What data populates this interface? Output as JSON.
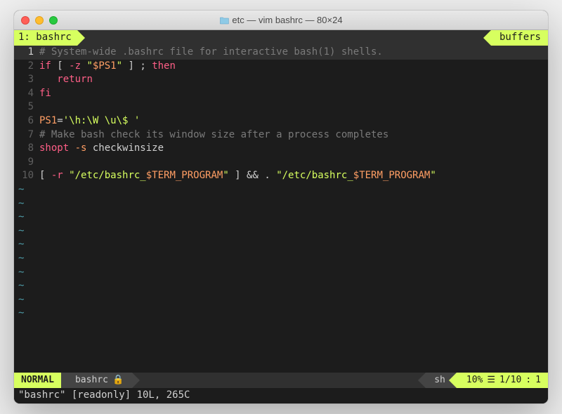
{
  "window": {
    "title": "etc — vim bashrc — 80×24"
  },
  "tabline": {
    "left": "1: bashrc",
    "right": "buffers"
  },
  "code": {
    "lines": [
      {
        "num": "1",
        "current": true,
        "segments": [
          {
            "cls": "c-comment",
            "t": "# System-wide .bashrc file for interactive bash(1) shells."
          }
        ]
      },
      {
        "num": "2",
        "segments": [
          {
            "cls": "c-keyword",
            "t": "if"
          },
          {
            "cls": "c-op",
            "t": " [ "
          },
          {
            "cls": "c-keyword",
            "t": "-z"
          },
          {
            "cls": "c-op",
            "t": " "
          },
          {
            "cls": "c-string",
            "t": "\""
          },
          {
            "cls": "c-var",
            "t": "$PS1"
          },
          {
            "cls": "c-string",
            "t": "\""
          },
          {
            "cls": "c-op",
            "t": " ] ; "
          },
          {
            "cls": "c-keyword",
            "t": "then"
          }
        ]
      },
      {
        "num": "3",
        "segments": [
          {
            "cls": "c-op",
            "t": "   "
          },
          {
            "cls": "c-keyword",
            "t": "return"
          }
        ]
      },
      {
        "num": "4",
        "segments": [
          {
            "cls": "c-keyword",
            "t": "fi"
          }
        ]
      },
      {
        "num": "5",
        "segments": []
      },
      {
        "num": "6",
        "segments": [
          {
            "cls": "c-var",
            "t": "PS1"
          },
          {
            "cls": "c-op",
            "t": "="
          },
          {
            "cls": "c-string",
            "t": "'\\h:\\W \\u\\$ '"
          }
        ]
      },
      {
        "num": "7",
        "segments": [
          {
            "cls": "c-comment",
            "t": "# Make bash check its window size after a process completes"
          }
        ]
      },
      {
        "num": "8",
        "segments": [
          {
            "cls": "c-builtin",
            "t": "shopt"
          },
          {
            "cls": "c-op",
            "t": " "
          },
          {
            "cls": "c-var",
            "t": "-s"
          },
          {
            "cls": "c-text",
            "t": " checkwinsize"
          }
        ]
      },
      {
        "num": "9",
        "segments": []
      },
      {
        "num": "10",
        "segments": [
          {
            "cls": "c-op",
            "t": "[ "
          },
          {
            "cls": "c-keyword",
            "t": "-r"
          },
          {
            "cls": "c-op",
            "t": " "
          },
          {
            "cls": "c-string",
            "t": "\"/etc/bashrc_"
          },
          {
            "cls": "c-var",
            "t": "$TERM_PROGRAM"
          },
          {
            "cls": "c-string",
            "t": "\""
          },
          {
            "cls": "c-op",
            "t": " ] && . "
          },
          {
            "cls": "c-string",
            "t": "\"/etc/bashrc_"
          },
          {
            "cls": "c-var",
            "t": "$TERM_PROGRAM"
          },
          {
            "cls": "c-string",
            "t": "\""
          }
        ]
      }
    ],
    "tilde_count": 10,
    "tilde": "~"
  },
  "statusline": {
    "mode": "NORMAL",
    "filename": "bashrc",
    "readonly_icon": "🔒",
    "filetype": "sh",
    "percent": "10%",
    "lines_icon": "☰",
    "lineinfo": "1/10",
    "sep": ":",
    "col": "1"
  },
  "cmdline": "\"bashrc\" [readonly] 10L, 265C"
}
